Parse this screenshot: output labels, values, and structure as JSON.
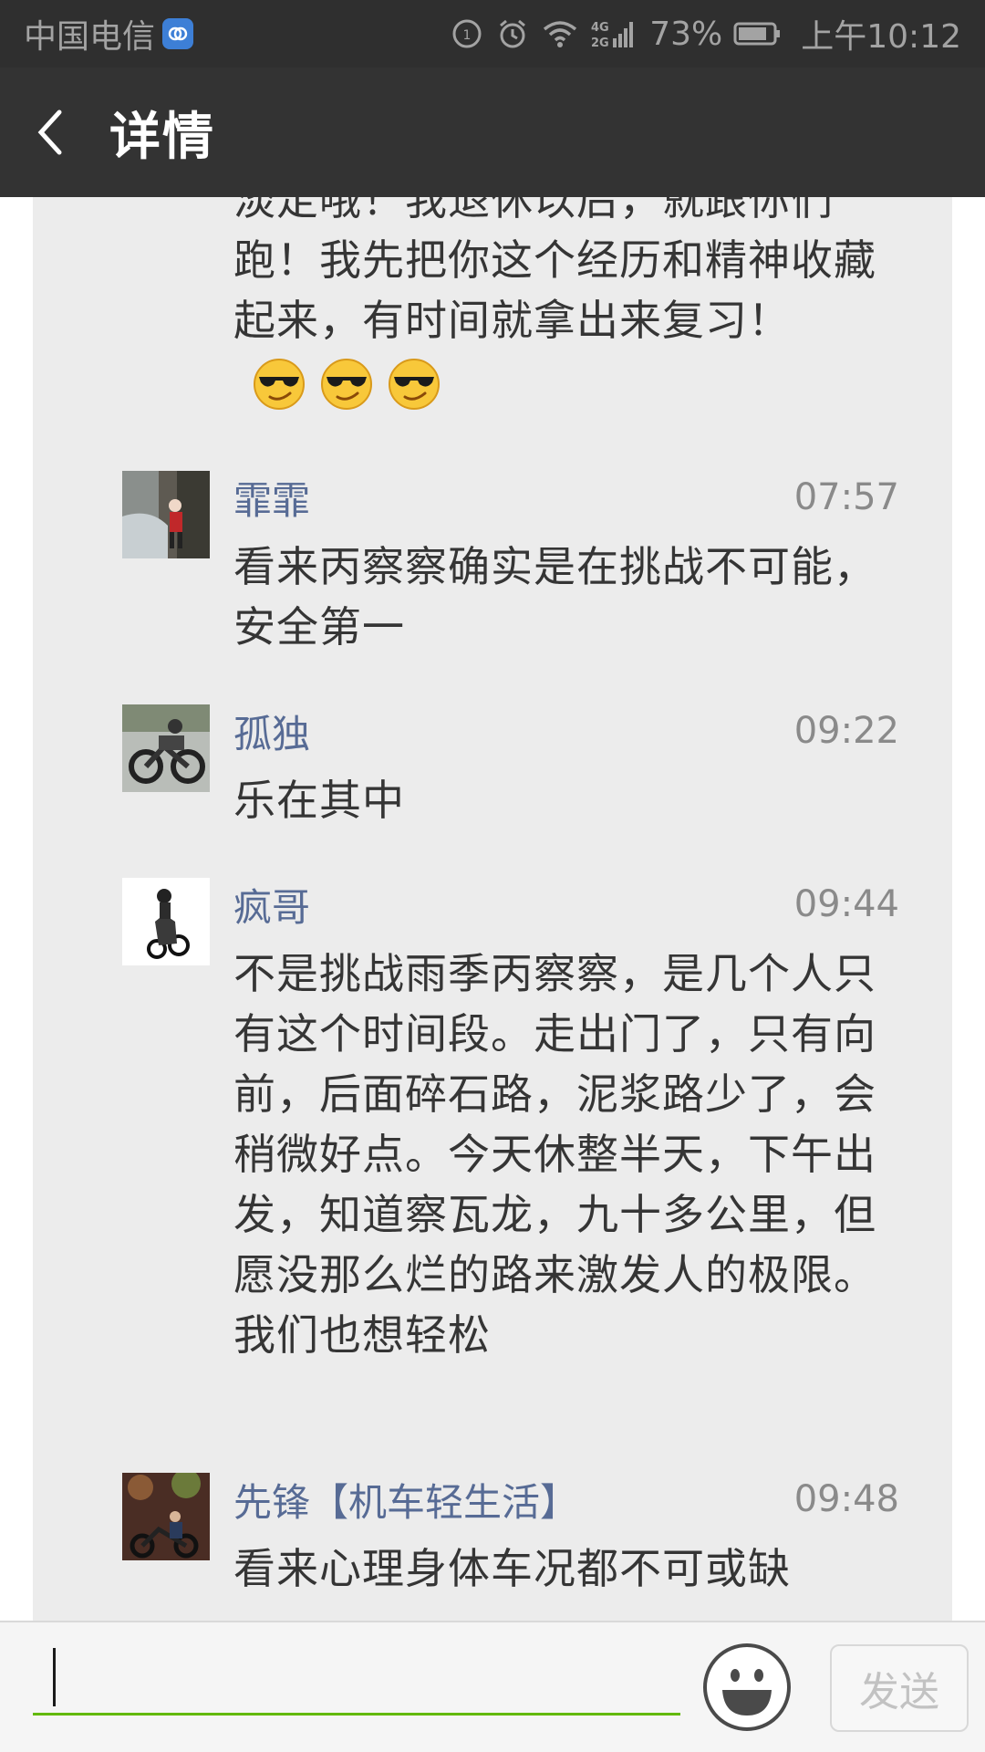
{
  "status_bar": {
    "carrier": "中国电信",
    "network": "4G 2G",
    "battery": "73%",
    "time": "上午10:12",
    "icons": [
      "carrier-badge-icon",
      "hd-call-icon",
      "alarm-icon",
      "wifi-icon",
      "signal-icon",
      "battery-icon"
    ]
  },
  "header": {
    "title": "详情",
    "back_icon": "chevron-left-icon"
  },
  "partial_comment": {
    "text": "淡定哦！我退休以后，就跟你们跑！我先把你这个经历和精神收藏起来，有时间就拿出来复习！",
    "emoji": [
      "sunglasses-emoji-icon",
      "sunglasses-emoji-icon",
      "sunglasses-emoji-icon"
    ]
  },
  "comments": [
    {
      "author": "霏霏",
      "time": "07:57",
      "text": "看来丙察察确实是在挑战不可能，安全第一"
    },
    {
      "author": "孤独",
      "time": "09:22",
      "text": "乐在其中"
    },
    {
      "author": "疯哥",
      "time": "09:44",
      "text": "不是挑战雨季丙察察，是几个人只有这个时间段。走出门了，只有向前，后面碎石路，泥浆路少了，会稍微好点。今天休整半天，下午出发，知道察瓦龙，九十多公里，但愿没那么烂的路来激发人的极限。我们也想轻松"
    },
    {
      "author": "先锋【机车轻生活】",
      "time": "09:48",
      "text": "看来心理身体车况都不可或缺"
    }
  ],
  "input": {
    "value": "",
    "placeholder": "",
    "emoji_icon": "emoji-face-icon",
    "send_label": "发送"
  },
  "colors": {
    "status_bar_bg": "#2f2f2f",
    "title_bar_bg": "#333333",
    "panel_bg": "#ececec",
    "author_color": "#576b95",
    "input_underline": "#62b900"
  }
}
